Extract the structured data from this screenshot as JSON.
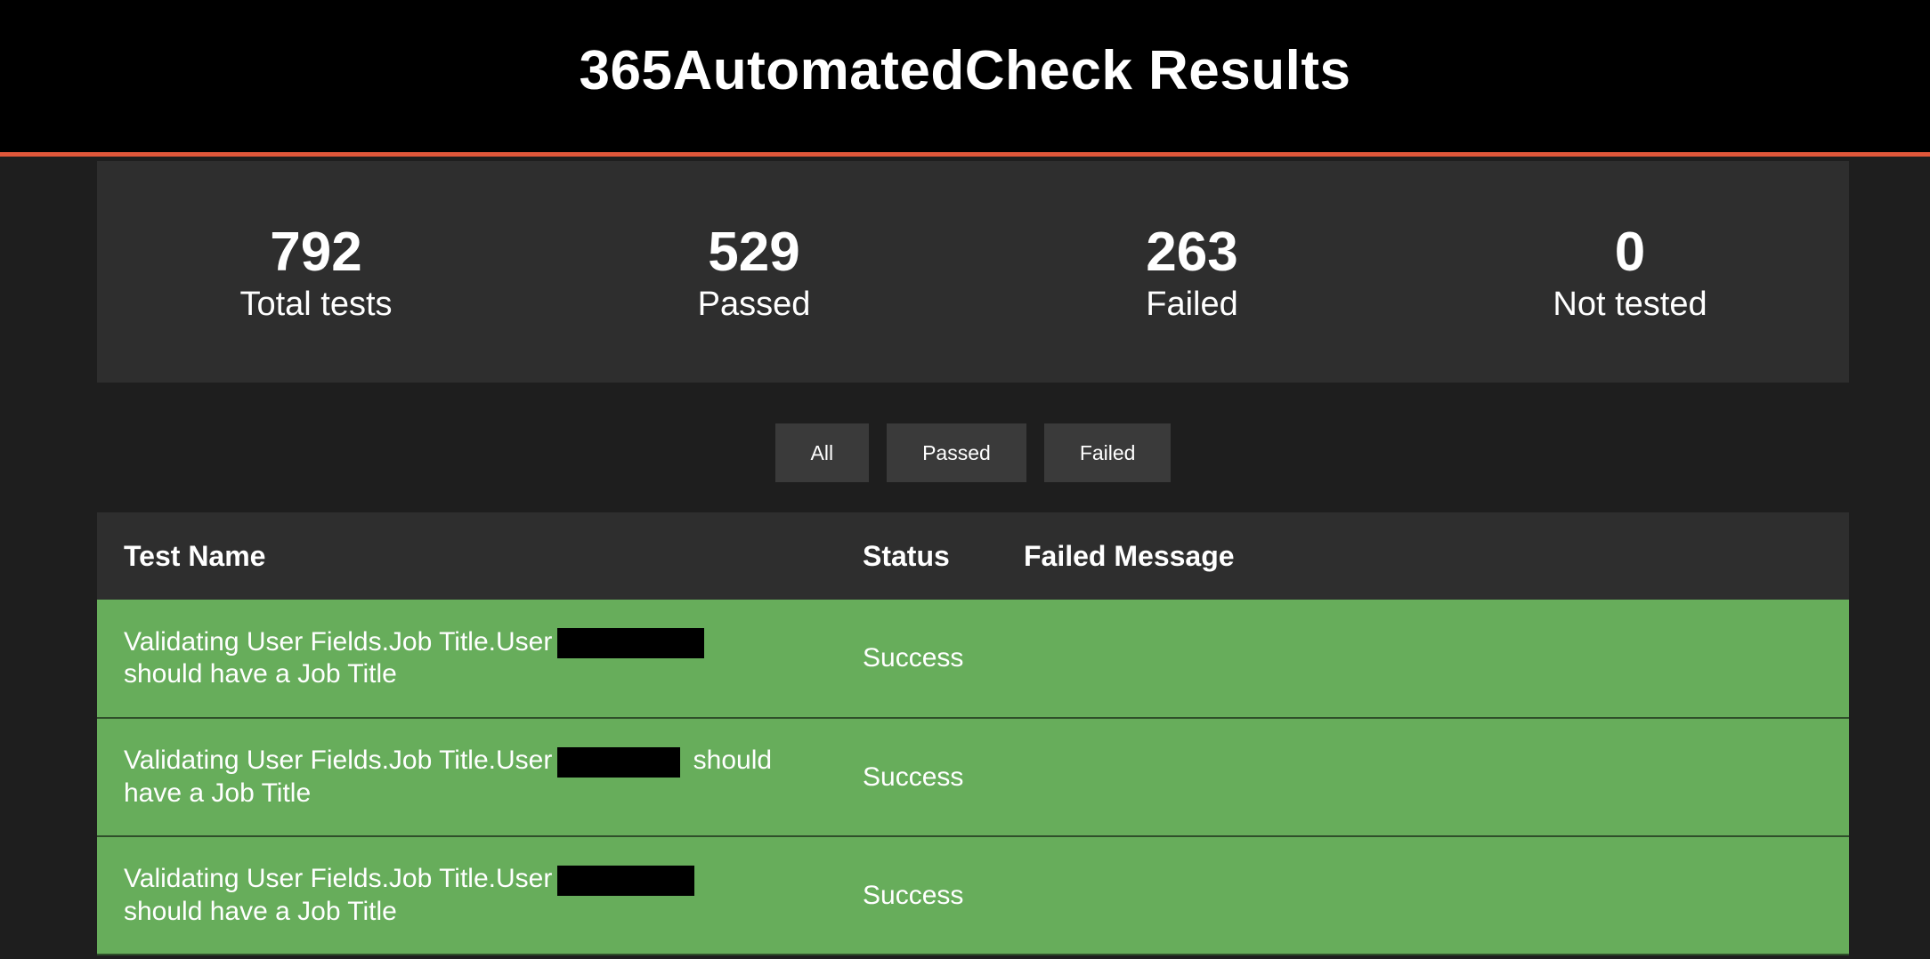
{
  "header": {
    "title": "365AutomatedCheck Results"
  },
  "summary": {
    "total": {
      "value": "792",
      "label": "Total tests"
    },
    "passed": {
      "value": "529",
      "label": "Passed"
    },
    "failed": {
      "value": "263",
      "label": "Failed"
    },
    "not_tested": {
      "value": "0",
      "label": "Not tested"
    }
  },
  "filters": {
    "all": "All",
    "passed": "Passed",
    "failed": "Failed"
  },
  "table": {
    "headers": {
      "name": "Test Name",
      "status": "Status",
      "message": "Failed Message"
    },
    "rows": [
      {
        "name_prefix": "Validating User Fields.Job Title.User",
        "name_suffix": "should have a Job Title",
        "status": "Success",
        "message": ""
      },
      {
        "name_prefix": "Validating User Fields.Job Title.User",
        "name_suffix": "should have a Job Title",
        "status": "Success",
        "message": ""
      },
      {
        "name_prefix": "Validating User Fields.Job Title.User",
        "name_suffix": "should have a Job Title",
        "status": "Success",
        "message": ""
      }
    ]
  },
  "colors": {
    "accent": "#e0573a",
    "success_row": "#67ad5b",
    "panel": "#2e2e2e",
    "background": "#1e1e1e"
  }
}
